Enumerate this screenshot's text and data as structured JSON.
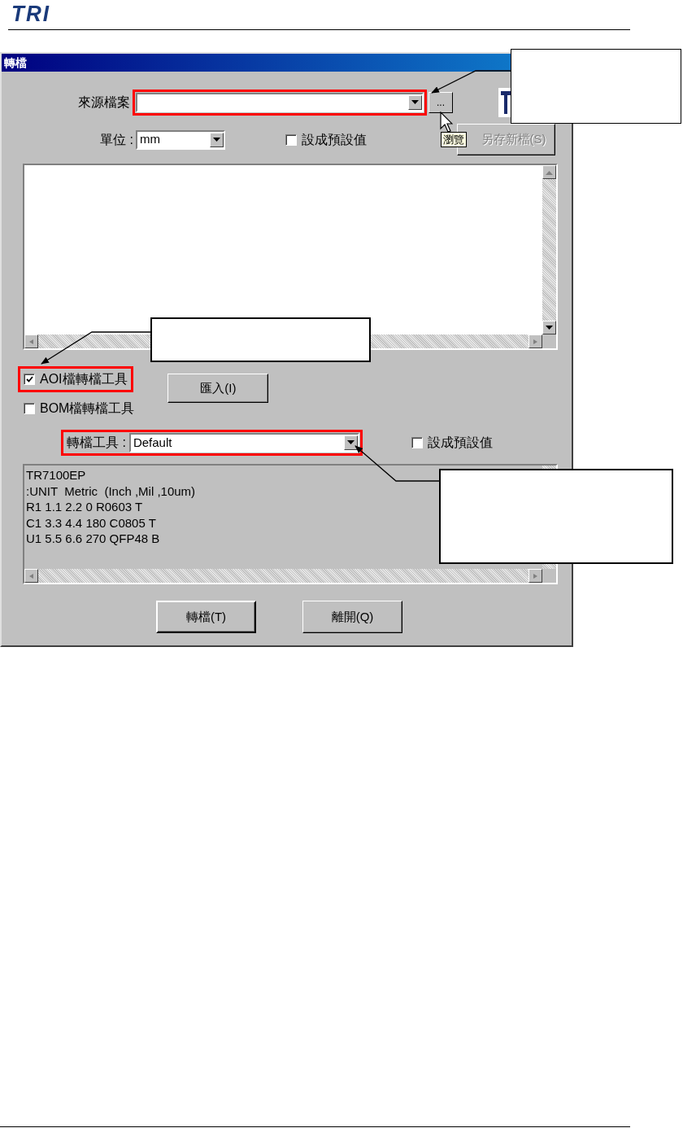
{
  "header": {
    "logo": "TRI"
  },
  "dialog": {
    "title": "轉檔",
    "source": {
      "label": "來源檔案",
      "highlighted": true
    },
    "browse_button": {
      "label": "...",
      "tooltip": "瀏覽"
    },
    "save_as_button": {
      "label": "另存新檔(S)",
      "disabled": true
    },
    "unit": {
      "label": "單位 :",
      "value": "mm"
    },
    "unit_default": {
      "label": "設成預設值",
      "checked": false
    },
    "file_types": [
      {
        "label": "AOI檔轉檔工具",
        "checked": true,
        "highlighted": true
      },
      {
        "label": "BOM檔轉檔工具",
        "checked": false,
        "highlighted": false
      }
    ],
    "import_button": {
      "label": "匯入(I)"
    },
    "converter": {
      "label": "轉檔工具 :",
      "value": "Default",
      "highlighted": true
    },
    "converter_default": {
      "label": "設成預設值",
      "checked": false
    },
    "output_lines": [
      "TR7100EP",
      ":UNIT  Metric  (Inch ,Mil ,10um)",
      "R1 1.1 2.2 0 R0603 T",
      "C1 3.3 4.4 180 C0805 T",
      "U1 5.5 6.6 270 QFP48 B"
    ],
    "buttons": [
      "轉檔(T)",
      "離開(Q)"
    ]
  }
}
